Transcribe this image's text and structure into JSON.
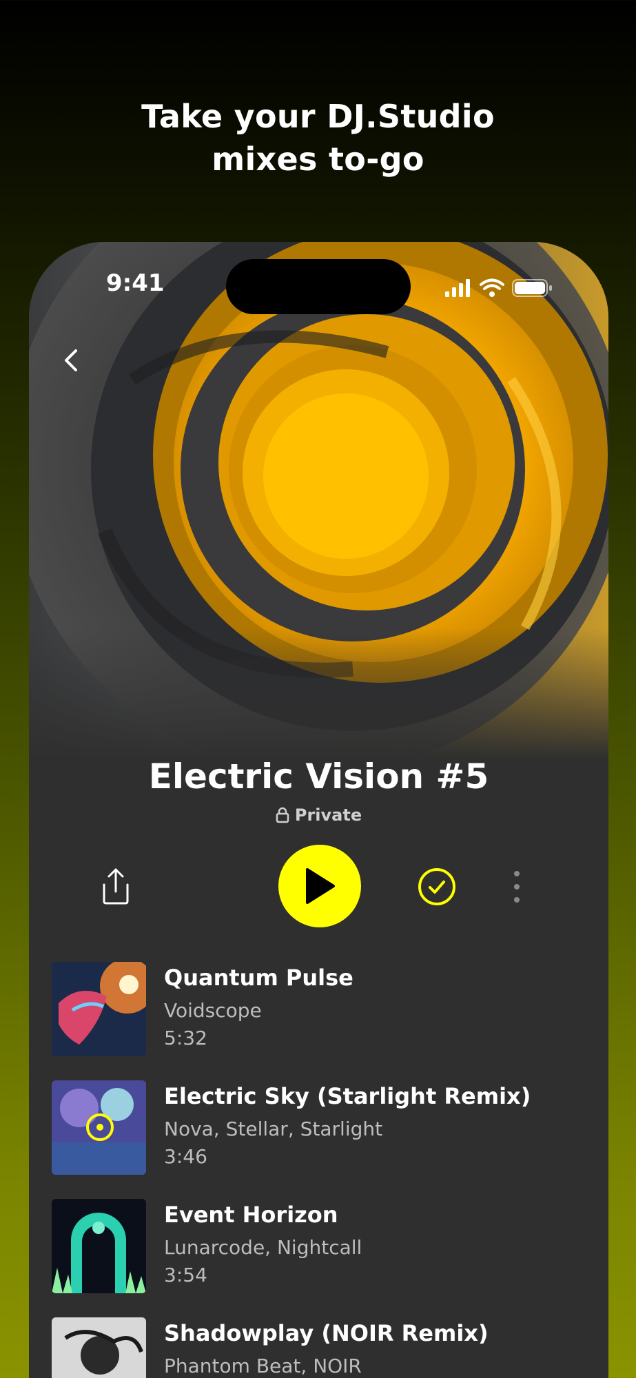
{
  "headline": {
    "line1": "Take your DJ.Studio",
    "line2": "mixes to-go"
  },
  "status_bar": {
    "time": "9:41"
  },
  "mix": {
    "title": "Electric Vision #5",
    "privacy": "Private"
  },
  "colors": {
    "accent": "#FFFF00",
    "panel": "#2F2F2F"
  },
  "icons": [
    "back-chevron-icon",
    "share-icon",
    "play-icon",
    "saved-check-icon",
    "more-icon",
    "lock-icon",
    "signal-icon",
    "wifi-icon",
    "battery-icon"
  ],
  "tracks": [
    {
      "title": "Quantum Pulse",
      "artists": "Voidscope",
      "duration": "5:32"
    },
    {
      "title": "Electric Sky (Starlight Remix)",
      "artists": "Nova, Stellar, Starlight",
      "duration": "3:46"
    },
    {
      "title": "Event Horizon",
      "artists": "Lunarcode, Nightcall",
      "duration": "3:54"
    },
    {
      "title": "Shadowplay (NOIR Remix)",
      "artists": "Phantom Beat, NOIR",
      "duration": ""
    }
  ]
}
